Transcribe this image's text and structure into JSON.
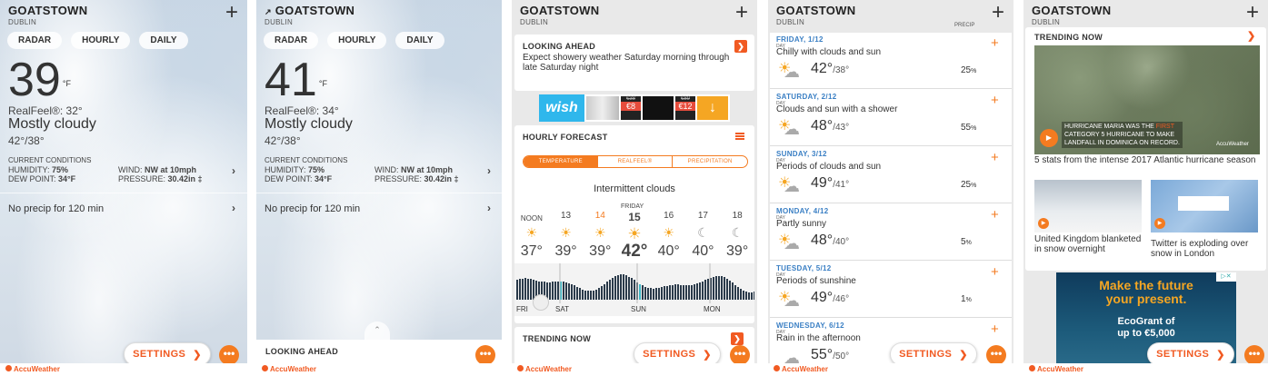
{
  "app": {
    "brand": "AccuWeather",
    "accent": "#f15a22",
    "settings_label": "SETTINGS",
    "more_label": "•••"
  },
  "location": {
    "city": "GOATSTOWN",
    "country": "DUBLIN",
    "city_with_arrow": "GOATSTOWN"
  },
  "tabs": [
    "RADAR",
    "HOURLY",
    "DAILY"
  ],
  "panel1": {
    "temp": "39",
    "unit": "°F",
    "realfeel": "RealFeel®: 32°",
    "phrase": "Mostly cloudy",
    "hilo": "42°/38°",
    "cc_label": "CURRENT CONDITIONS",
    "humidity_label": "HUMIDITY:",
    "humidity": "75%",
    "dew_label": "DEW POINT:",
    "dew": "34°F",
    "wind_label": "WIND:",
    "wind": "NW at 10mph",
    "pressure_label": "PRESSURE:",
    "pressure": "30.42in ‡",
    "precip": "No precip for 120 min"
  },
  "panel2": {
    "temp": "41",
    "unit": "°F",
    "realfeel": "RealFeel®: 34°",
    "phrase": "Mostly cloudy",
    "hilo": "42°/38°",
    "cc_label": "CURRENT CONDITIONS",
    "humidity_label": "HUMIDITY:",
    "humidity": "75%",
    "dew_label": "DEW POINT:",
    "dew": "34°F",
    "wind_label": "WIND:",
    "wind": "NW at 10mph",
    "pressure_label": "PRESSURE:",
    "pressure": "30.42in ‡",
    "precip": "No precip for 120 min",
    "looking_ahead": "LOOKING AHEAD"
  },
  "panel3": {
    "looking_ahead_title": "LOOKING AHEAD",
    "looking_ahead_text": "Expect showery weather Saturday morning through late Saturday night",
    "ad": {
      "logo": "wish",
      "price1_old": "€38",
      "price1": "€8",
      "price2_old": "€89",
      "price2": "€12"
    },
    "hourly_title": "HOURLY FORECAST",
    "seg": [
      "TEMPERATURE",
      "REALFEEL®",
      "PRECIPITATION"
    ],
    "summary": "Intermittent clouds",
    "day_label": "FRIDAY",
    "hours": [
      "NOON",
      "13",
      "14",
      "15",
      "16",
      "17",
      "18"
    ],
    "temps": [
      "37°",
      "39°",
      "39°",
      "42°",
      "40°",
      "40°",
      "39°"
    ],
    "timeline": [
      "FRI",
      "SAT",
      "SUN",
      "MON"
    ],
    "trending_title": "TRENDING NOW"
  },
  "panel4": {
    "precip_header": "PRECIP",
    "days": [
      {
        "name": "FRIDAY, 1/12",
        "tag": "DAY",
        "phrase": "Chilly with clouds and sun",
        "hi": "42°",
        "lo": "/38°",
        "pct": "25",
        "pct_unit": "%"
      },
      {
        "name": "SATURDAY, 2/12",
        "tag": "DAY",
        "phrase": "Clouds and sun with a shower",
        "hi": "48°",
        "lo": "/43°",
        "pct": "55",
        "pct_unit": "%"
      },
      {
        "name": "SUNDAY, 3/12",
        "tag": "DAY",
        "phrase": "Periods of clouds and sun",
        "hi": "49°",
        "lo": "/41°",
        "pct": "25",
        "pct_unit": "%"
      },
      {
        "name": "MONDAY, 4/12",
        "tag": "DAY",
        "phrase": "Partly sunny",
        "hi": "48°",
        "lo": "/40°",
        "pct": "5",
        "pct_unit": "%"
      },
      {
        "name": "TUESDAY, 5/12",
        "tag": "DAY",
        "phrase": "Periods of sunshine",
        "hi": "49°",
        "lo": "/46°",
        "pct": "1",
        "pct_unit": "%"
      },
      {
        "name": "WEDNESDAY, 6/12",
        "tag": "DAY",
        "phrase": "Rain in the afternoon",
        "hi": "55°",
        "lo": "/50°",
        "pct": "",
        "pct_unit": ""
      }
    ]
  },
  "panel5": {
    "trending_title": "TRENDING NOW",
    "hero_caption_1": "HURRICANE MARIA WAS THE",
    "hero_caption_red": "FIRST",
    "hero_caption_2": "CATEGORY 5 HURRICANE TO MAKE",
    "hero_caption_3": "LANDFALL IN DOMINICA ON RECORD.",
    "hero_watermark": "AccuWeather",
    "headline": "5 stats from the intense 2017 Atlantic hurricane season",
    "story1": "United Kingdom blanketed in snow overnight",
    "story2": "Twitter is exploding over snow in London",
    "ad_line1": "Make the future",
    "ad_line2": "your present.",
    "ad_line3": "EcoGrant of",
    "ad_line4": "up to €5,000"
  }
}
